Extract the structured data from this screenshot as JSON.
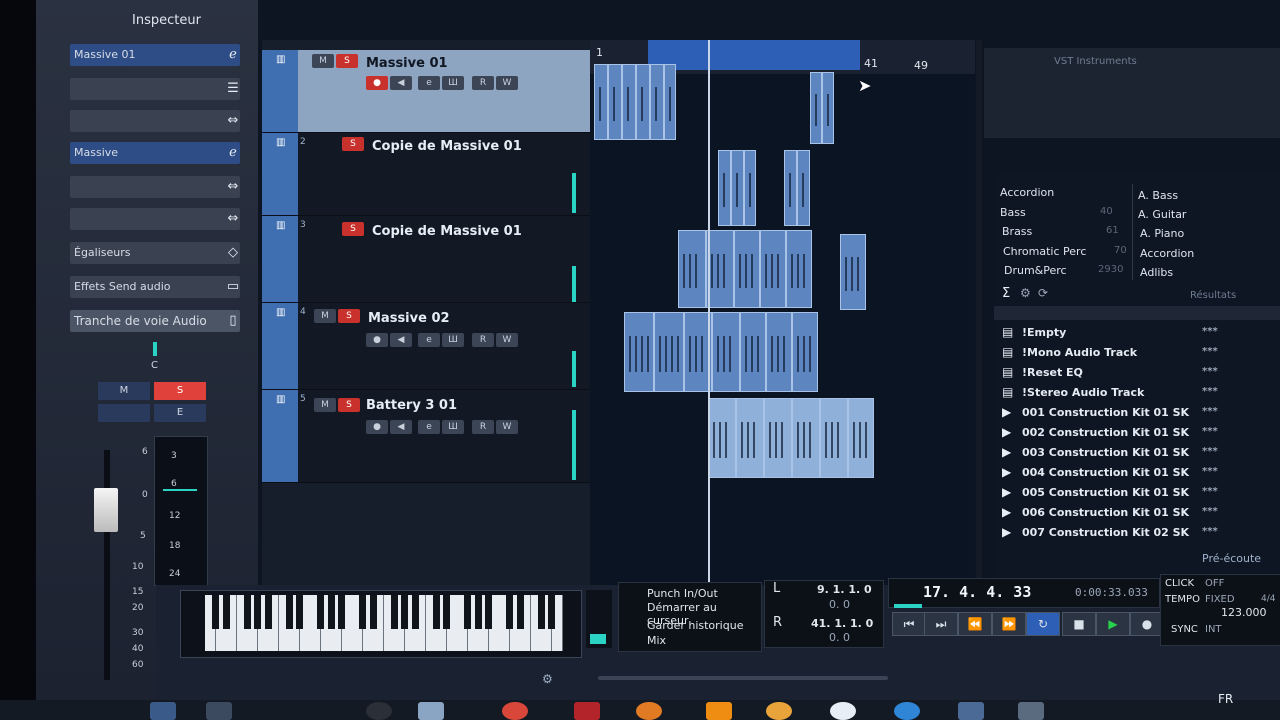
{
  "inspector": {
    "title": "Inspecteur",
    "instrument_label": "Massive 01",
    "instrument2_label": "Massive",
    "sections": [
      "Égaliseurs",
      "Effets Send audio",
      "Tranche de voie Audio"
    ],
    "channel_letter": "C",
    "mute_label": "M",
    "solo_label": "S",
    "e_label": "E",
    "fader_scale": [
      "6",
      "0",
      "5",
      "10",
      "15",
      "20",
      "30",
      "40",
      "60"
    ],
    "meter_scale": [
      "3",
      "6",
      "12",
      "18",
      "24"
    ]
  },
  "tracks": [
    {
      "num": "1",
      "name": "Massive 01"
    },
    {
      "num": "2",
      "name": "Copie de Massive 01"
    },
    {
      "num": "3",
      "name": "Copie de Massive 01"
    },
    {
      "num": "4",
      "name": "Massive 02"
    },
    {
      "num": "5",
      "name": "Battery 3 01"
    }
  ],
  "track_buttons": {
    "m": "M",
    "s": "S",
    "r": "R",
    "w": "W",
    "e": "e"
  },
  "ruler": {
    "start": "1",
    "end_loop": "41",
    "end": "49"
  },
  "vst": {
    "title": "VST Instruments"
  },
  "media_bay": {
    "categories_left": [
      {
        "name": "Accordion",
        "count": ""
      },
      {
        "name": "Bass",
        "count": "40"
      },
      {
        "name": "Brass",
        "count": "61"
      },
      {
        "name": "Chromatic Perc",
        "count": "70"
      },
      {
        "name": "Drum&Perc",
        "count": "2930"
      }
    ],
    "categories_right": [
      "A. Bass",
      "A. Guitar",
      "A. Piano",
      "Accordion",
      "Adlibs"
    ],
    "results_label": "Résultats",
    "results": [
      {
        "icon": "list-icon",
        "name": "!Empty",
        "stars": "***"
      },
      {
        "icon": "list-icon",
        "name": "!Mono Audio Track",
        "stars": "***"
      },
      {
        "icon": "list-icon",
        "name": "!Reset EQ",
        "stars": "***"
      },
      {
        "icon": "list-icon",
        "name": "!Stereo Audio Track",
        "stars": "***"
      },
      {
        "icon": "play-icon",
        "name": "001 Construction Kit 01 SK",
        "stars": "***"
      },
      {
        "icon": "play-icon",
        "name": "002 Construction Kit 01 SK",
        "stars": "***"
      },
      {
        "icon": "play-icon",
        "name": "003 Construction Kit 01 SK",
        "stars": "***"
      },
      {
        "icon": "play-icon",
        "name": "004 Construction Kit 01 SK",
        "stars": "***"
      },
      {
        "icon": "play-icon",
        "name": "005 Construction Kit 01 SK",
        "stars": "***"
      },
      {
        "icon": "play-icon",
        "name": "006 Construction Kit 01 SK",
        "stars": "***"
      },
      {
        "icon": "play-icon",
        "name": "007 Construction Kit 02 SK",
        "stars": "***"
      }
    ],
    "preview_label": "Pré-écoute"
  },
  "transport": {
    "options": [
      "Punch In/Out",
      "Démarrer au curseur",
      "Garder historique",
      "Mix"
    ],
    "left_locator": "9. 1. 1.   0",
    "left_sub": "0.   0",
    "right_locator": "41. 1. 1.   0",
    "right_sub": "0.   0",
    "L": "L",
    "R": "R",
    "position": "17. 4. 4. 33",
    "time": "0:00:33.033",
    "click_label": "CLICK",
    "click_value": "OFF",
    "tempo_label": "TEMPO",
    "tempo_mode": "FIXED",
    "signature": "4/4",
    "tempo_value": "123.000",
    "sync_label": "SYNC",
    "sync_value": "INT"
  },
  "taskbar": {
    "lang": "FR"
  }
}
